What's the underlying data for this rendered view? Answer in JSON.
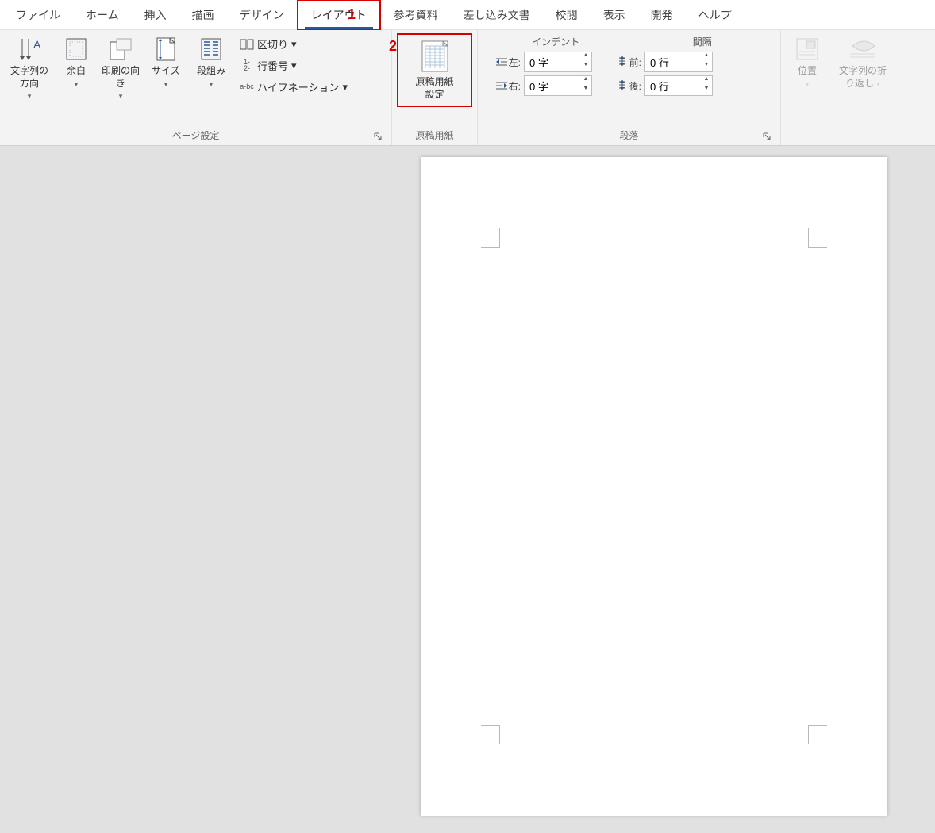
{
  "tabs": {
    "file": "ファイル",
    "home": "ホーム",
    "insert": "挿入",
    "draw": "描画",
    "design": "デザイン",
    "layout": "レイアウト",
    "references": "参考資料",
    "mailings": "差し込み文書",
    "review": "校閲",
    "view": "表示",
    "developer": "開発",
    "help": "ヘルプ"
  },
  "annotations": {
    "one": "1",
    "two": "2"
  },
  "page_setup": {
    "text_direction": "文字列の方向",
    "margins": "余白",
    "orientation": "印刷の向き",
    "size": "サイズ",
    "columns": "段組み",
    "breaks": "区切り",
    "line_numbers": "行番号",
    "hyphenation": "ハイフネーション",
    "group_label": "ページ設定"
  },
  "genko": {
    "button_line1": "原稿用紙",
    "button_line2": "設定",
    "group_label": "原稿用紙"
  },
  "paragraph": {
    "indent_head": "インデント",
    "spacing_head": "間隔",
    "left_label": "左:",
    "right_label": "右:",
    "before_label": "前:",
    "after_label": "後:",
    "left_value": "0 字",
    "right_value": "0 字",
    "before_value": "0 行",
    "after_value": "0 行",
    "group_label": "段落"
  },
  "arrange": {
    "position": "位置",
    "wrap_line1": "文字列の折",
    "wrap_line2": "り返し"
  },
  "icons": {
    "breaks_prefix": "a-bc"
  }
}
